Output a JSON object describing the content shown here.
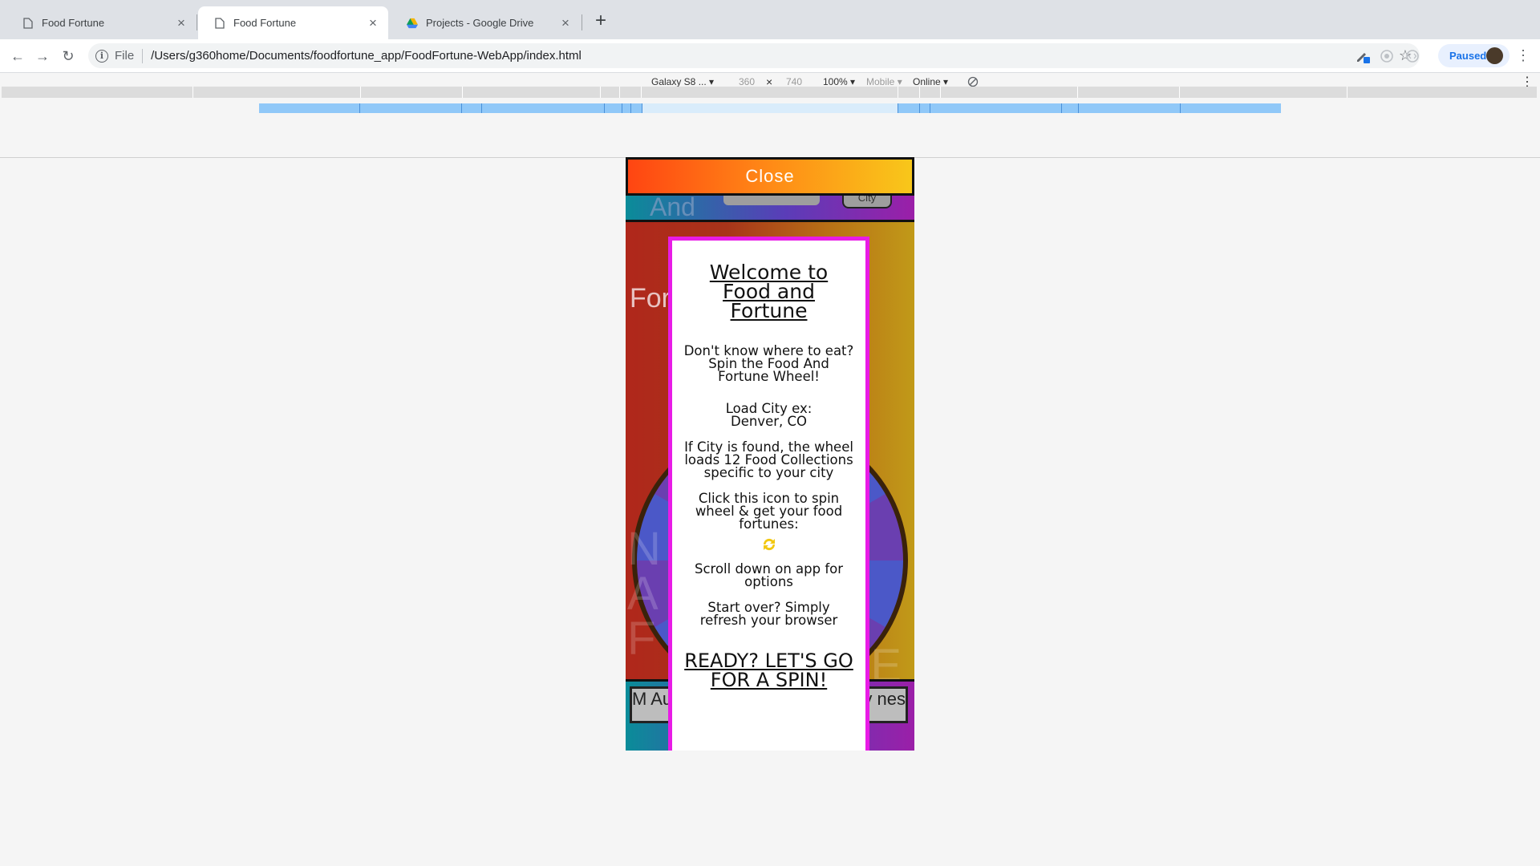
{
  "browser": {
    "tabs": [
      {
        "title": "Food Fortune",
        "icon": "page-icon",
        "active": false
      },
      {
        "title": "Food Fortune",
        "icon": "page-icon",
        "active": true
      },
      {
        "title": "Projects - Google Drive",
        "icon": "google-drive-icon",
        "active": false
      }
    ],
    "new_tab_glyph": "+",
    "address": {
      "scheme": "File",
      "url": "/Users/g360home/Documents/foodfortune_app/FoodFortune-WebApp/index.html"
    },
    "profile_status": "Paused"
  },
  "device_toolbar": {
    "device": "Galaxy S8 ...",
    "width": "360",
    "times": "×",
    "height": "740",
    "zoom": "100%",
    "mode": "Mobile",
    "network": "Online"
  },
  "app": {
    "close_label": "Close",
    "background": {
      "and_text": "And",
      "fortune_text": "Fortune",
      "city_button": "City",
      "bottom_left": "M Au",
      "bottom_right": "y nes"
    },
    "modal": {
      "title": "Welcome to Food and Fortune",
      "p1": "Don't know where to eat? Spin the Food And Fortune Wheel!",
      "p2": "Load City ex: Denver, CO",
      "p3": "If City is found, the wheel loads 12 Food Collections specific to your city",
      "p4": "Click this icon to spin wheel & get your food fortunes:",
      "spin_icon": "refresh-icon",
      "p5": "Scroll down on app for options",
      "p6": "Start over? Simply refresh your browser",
      "cta": "READY? LET'S GO FOR A SPIN!"
    }
  },
  "colors": {
    "modal_border": "#e81be6",
    "close_gradient_start": "#ff4512",
    "close_gradient_end": "#f8c71a",
    "spin_icon": "#f2c811",
    "accent_blue": "#1a73e8"
  }
}
